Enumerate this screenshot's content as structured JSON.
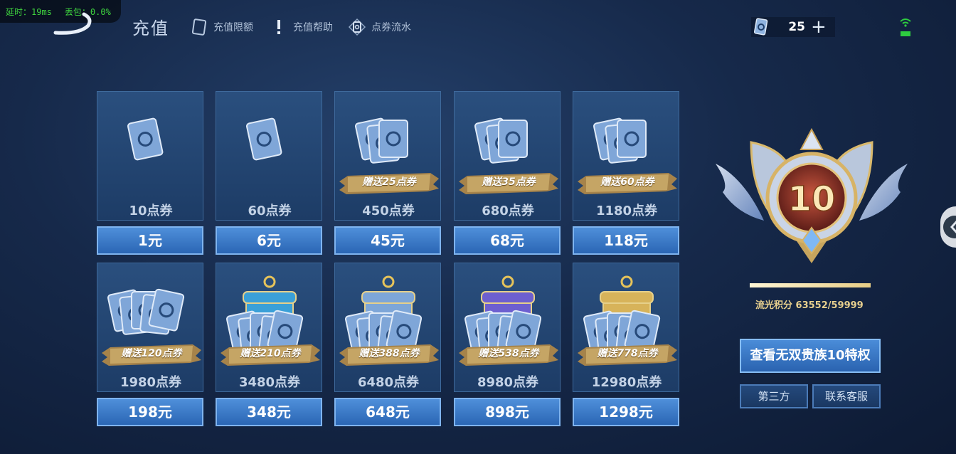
{
  "overlay": {
    "latency": "延时：19ms",
    "packet_loss": "丢包：0.0%"
  },
  "header": {
    "title": "充值",
    "links": [
      {
        "label": "充值限额",
        "icon": "voucher-icon"
      },
      {
        "label": "充值帮助",
        "icon": "exclamation-icon"
      },
      {
        "label": "点券流水",
        "icon": "voucher-ticket-icon"
      }
    ],
    "balance": "25",
    "balance_icon": "voucher-icon",
    "add_icon": "plus-icon",
    "signal_icon": "wifi-icon"
  },
  "packages": [
    {
      "name": "10点券",
      "price": "1元",
      "bonus": ""
    },
    {
      "name": "60点券",
      "price": "6元",
      "bonus": ""
    },
    {
      "name": "450点券",
      "price": "45元",
      "bonus": "赠送25点券"
    },
    {
      "name": "680点券",
      "price": "68元",
      "bonus": "赠送35点券"
    },
    {
      "name": "1180点券",
      "price": "118元",
      "bonus": "赠送60点券"
    },
    {
      "name": "1980点券",
      "price": "198元",
      "bonus": "赠送120点券"
    },
    {
      "name": "3480点券",
      "price": "348元",
      "bonus": "赠送210点券"
    },
    {
      "name": "6480点券",
      "price": "648元",
      "bonus": "赠送388点券"
    },
    {
      "name": "8980点券",
      "price": "898元",
      "bonus": "赠送538点券"
    },
    {
      "name": "12980点券",
      "price": "1298元",
      "bonus": "赠送778点券"
    }
  ],
  "vip": {
    "level": "10",
    "points_text": "流光积分 63552/59999",
    "progress": 1.0,
    "privilege_button": "查看无双贵族10特权",
    "third_party_button": "第三方",
    "support_button": "联系客服"
  },
  "colors": {
    "accent_blue": "#2b66b4",
    "gold": "#e7cd86",
    "ribbon": "#a6834a",
    "signal": "#2ecc40"
  }
}
